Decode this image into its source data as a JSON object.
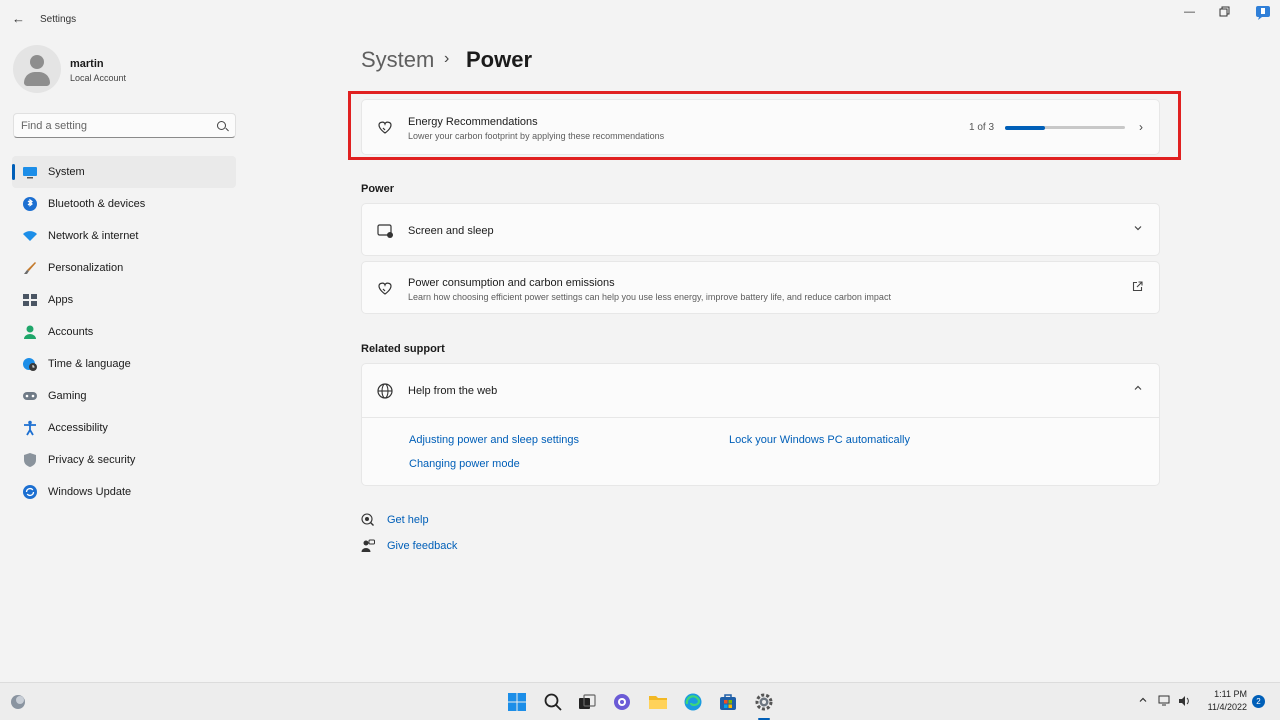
{
  "window": {
    "app_title": "Settings",
    "controls": [
      "minimize",
      "restore",
      "close"
    ]
  },
  "profile": {
    "name": "martin",
    "account_type": "Local Account"
  },
  "search": {
    "placeholder": "Find a setting"
  },
  "nav": {
    "items": [
      {
        "label": "System",
        "icon": "monitor-icon",
        "active": true
      },
      {
        "label": "Bluetooth & devices",
        "icon": "bluetooth-icon"
      },
      {
        "label": "Network & internet",
        "icon": "wifi-icon"
      },
      {
        "label": "Personalization",
        "icon": "brush-icon"
      },
      {
        "label": "Apps",
        "icon": "apps-icon"
      },
      {
        "label": "Accounts",
        "icon": "person-icon"
      },
      {
        "label": "Time & language",
        "icon": "globe-clock-icon"
      },
      {
        "label": "Gaming",
        "icon": "gamepad-icon"
      },
      {
        "label": "Accessibility",
        "icon": "accessibility-icon"
      },
      {
        "label": "Privacy & security",
        "icon": "shield-icon"
      },
      {
        "label": "Windows Update",
        "icon": "update-icon"
      }
    ]
  },
  "header": {
    "parent": "System",
    "separator": "›",
    "current": "Power"
  },
  "energy": {
    "title": "Energy Recommendations",
    "subtitle": "Lower your carbon footprint by applying these recommendations",
    "progress_label": "1 of 3",
    "progress_fraction": 0.333
  },
  "power_section": {
    "label": "Power",
    "screen_sleep": {
      "title": "Screen and sleep"
    },
    "consumption": {
      "title": "Power consumption and carbon emissions",
      "subtitle": "Learn how choosing efficient power settings can help you use less energy, improve battery life, and reduce carbon impact"
    }
  },
  "related": {
    "label": "Related support",
    "help_title": "Help from the web",
    "links": [
      "Adjusting power and sleep settings",
      "Lock your Windows PC automatically",
      "Changing power mode"
    ]
  },
  "footer_links": {
    "get_help": "Get help",
    "give_feedback": "Give feedback"
  },
  "taskbar": {
    "time": "1:11 PM",
    "date": "11/4/2022",
    "notification_count": "2"
  },
  "colors": {
    "accent": "#005fb8",
    "highlight": "#e02020"
  }
}
